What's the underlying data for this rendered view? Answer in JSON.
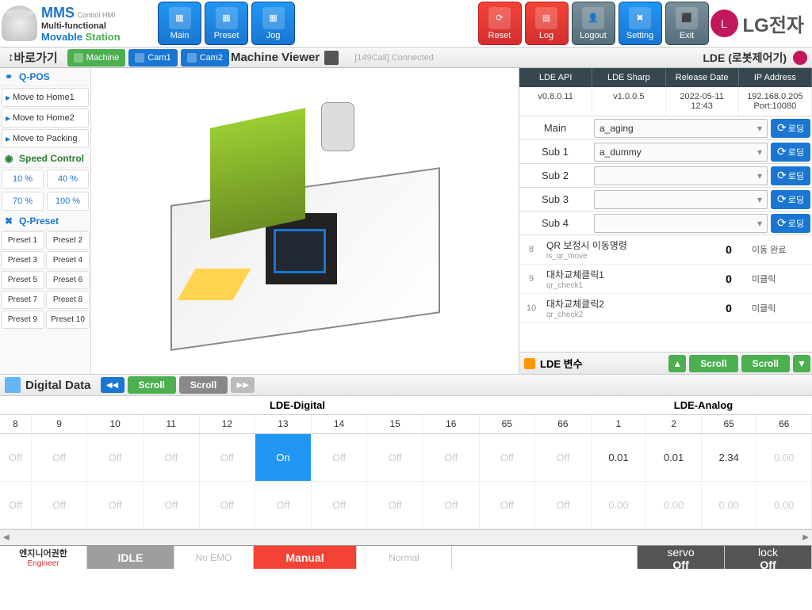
{
  "header": {
    "mms_title": "MMS",
    "mms_subtitle": "Control HMI",
    "line1": "Multi-functional",
    "line2a": "Movable",
    "line2b": "Station",
    "buttons": {
      "main": "Main",
      "preset": "Preset",
      "jog": "Jog",
      "reset": "Reset",
      "log": "Log",
      "logout": "Logout",
      "setting": "Setting",
      "exit": "Exit"
    },
    "lg_text": "LG전자"
  },
  "subbar": {
    "shortcut": "바로가기",
    "tabs": {
      "machine": "Machine",
      "cam1": "Cam1",
      "cam2": "Cam2"
    },
    "viewer_title": "Machine Viewer",
    "conn_status": "[149Call] Connected",
    "lde_title": "LDE (로봇제어기)"
  },
  "sidebar": {
    "qpos_title": "Q-POS",
    "qpos": [
      "Move to Home1",
      "Move to Home2",
      "Move to Packing"
    ],
    "speed_title": "Speed Control",
    "speeds": [
      [
        "10 %",
        "40 %"
      ],
      [
        "70 %",
        "100 %"
      ]
    ],
    "qpreset_title": "Q-Preset",
    "presets": [
      [
        "Preset 1",
        "Preset 2"
      ],
      [
        "Preset 3",
        "Preset 4"
      ],
      [
        "Preset 5",
        "Preset 6"
      ],
      [
        "Preset 7",
        "Preset 8"
      ],
      [
        "Preset 9",
        "Preset 10"
      ]
    ]
  },
  "right": {
    "headers": [
      "LDE API",
      "LDE Sharp",
      "Release Date",
      "IP Address"
    ],
    "values": [
      "v0.8.0.11",
      "v1.0.0.5",
      "2022-05-11 12:43",
      "192.168.0.205 Port:10080"
    ],
    "dd_labels": [
      "Main",
      "Sub 1",
      "Sub 2",
      "Sub 3",
      "Sub 4"
    ],
    "dd_values": [
      "a_aging",
      "a_dummy",
      "",
      "",
      ""
    ],
    "reload_label": "로딩",
    "vars": [
      {
        "idx": "8",
        "title": "QR 보정시 이동명령",
        "sub": "is_qr_move",
        "val": "0",
        "status": "이동 완료"
      },
      {
        "idx": "9",
        "title": "대차교체클릭1",
        "sub": "qr_check1",
        "val": "0",
        "status": "미클릭"
      },
      {
        "idx": "10",
        "title": "대차교체클릭2",
        "sub": "qr_check2",
        "val": "0",
        "status": "미클릭"
      }
    ],
    "footer_label": "LDE 변수",
    "scroll_label": "Scroll"
  },
  "digital": {
    "title": "Digital Data",
    "scroll_label": "Scroll",
    "section_digital": "LDE-Digital",
    "section_analog": "LDE-Analog",
    "d_cols": [
      "8",
      "9",
      "10",
      "11",
      "12",
      "13",
      "14",
      "15",
      "16",
      "65",
      "66"
    ],
    "a_cols": [
      "1",
      "2",
      "65",
      "66"
    ],
    "d_row1": [
      "Off",
      "Off",
      "Off",
      "Off",
      "Off",
      "On",
      "Off",
      "Off",
      "Off",
      "Off",
      "Off"
    ],
    "d_row1_on_idx": 5,
    "a_row1": [
      "0.01",
      "0.01",
      "2.34",
      "0.00"
    ],
    "a_row1_off_idx": 3,
    "d_row2": [
      "Off",
      "Off",
      "Off",
      "Off",
      "Off",
      "Off",
      "Off",
      "Off",
      "Off",
      "Off",
      "Off"
    ],
    "a_row2": [
      "0.00",
      "0.00",
      "0.00",
      "0.00"
    ]
  },
  "status": {
    "role_title": "엔지니어권한",
    "role_sub": "Engineer",
    "idle": "IDLE",
    "noemo": "No EMO",
    "manual": "Manual",
    "normal": "Normal",
    "servo_label": "servo",
    "servo_val": "Off",
    "lock_label": "lock",
    "lock_val": "Off"
  }
}
